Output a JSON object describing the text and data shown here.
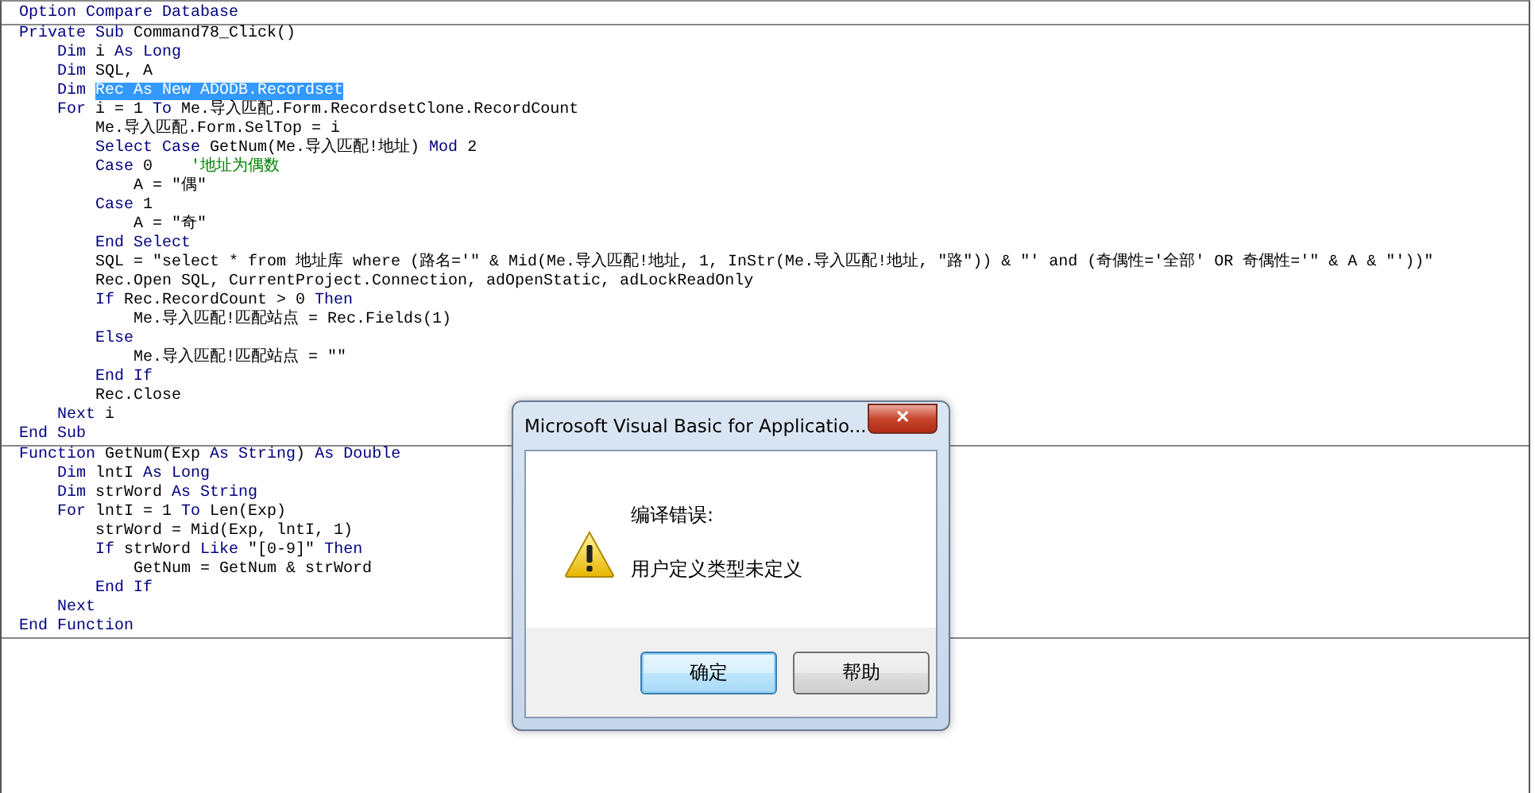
{
  "code_sections": [
    {
      "lines": [
        [
          {
            "kind": "keyword",
            "text": "Option Compare Database"
          }
        ]
      ]
    },
    {
      "lines": [
        [
          {
            "kind": "keyword",
            "text": "Private Sub "
          },
          {
            "kind": "plain",
            "text": "Command78_Click()"
          }
        ],
        [
          {
            "kind": "keyword",
            "text": "    Dim "
          },
          {
            "kind": "plain",
            "text": "i "
          },
          {
            "kind": "keyword",
            "text": "As Long"
          }
        ],
        [
          {
            "kind": "keyword",
            "text": "    Dim "
          },
          {
            "kind": "plain",
            "text": "SQL, A"
          }
        ],
        [
          {
            "kind": "keyword",
            "text": "    Dim "
          },
          {
            "kind": "selected",
            "text": "Rec As New ADODB.Recordset"
          }
        ],
        [
          {
            "kind": "keyword",
            "text": "    For "
          },
          {
            "kind": "plain",
            "text": "i = 1 "
          },
          {
            "kind": "keyword",
            "text": "To "
          },
          {
            "kind": "plain",
            "text": "Me.导入匹配.Form.RecordsetClone.RecordCount"
          }
        ],
        [
          {
            "kind": "plain",
            "text": "        Me.导入匹配.Form.SelTop = i"
          }
        ],
        [
          {
            "kind": "keyword",
            "text": "        Select Case "
          },
          {
            "kind": "plain",
            "text": "GetNum(Me.导入匹配!地址) "
          },
          {
            "kind": "keyword",
            "text": "Mod "
          },
          {
            "kind": "plain",
            "text": "2"
          }
        ],
        [
          {
            "kind": "keyword",
            "text": "        Case "
          },
          {
            "kind": "plain",
            "text": "0    "
          },
          {
            "kind": "comment",
            "text": "'地址为偶数"
          }
        ],
        [
          {
            "kind": "plain",
            "text": "            A = \"偶\""
          }
        ],
        [
          {
            "kind": "keyword",
            "text": "        Case "
          },
          {
            "kind": "plain",
            "text": "1"
          }
        ],
        [
          {
            "kind": "plain",
            "text": "            A = \"奇\""
          }
        ],
        [
          {
            "kind": "keyword",
            "text": "        End Select"
          }
        ],
        [
          {
            "kind": "plain",
            "text": "        SQL = \"select * from 地址库 where (路名='\" & Mid(Me.导入匹配!地址, 1, InStr(Me.导入匹配!地址, \"路\")) & \"' and (奇偶性='全部' OR 奇偶性='\" & A & \"'))\""
          }
        ],
        [
          {
            "kind": "plain",
            "text": "        Rec.Open SQL, CurrentProject.Connection, adOpenStatic, adLockReadOnly"
          }
        ],
        [
          {
            "kind": "keyword",
            "text": "        If "
          },
          {
            "kind": "plain",
            "text": "Rec.RecordCount > 0 "
          },
          {
            "kind": "keyword",
            "text": "Then"
          }
        ],
        [
          {
            "kind": "plain",
            "text": "            Me.导入匹配!匹配站点 = Rec.Fields(1)"
          }
        ],
        [
          {
            "kind": "keyword",
            "text": "        Else"
          }
        ],
        [
          {
            "kind": "plain",
            "text": "            Me.导入匹配!匹配站点 = \"\""
          }
        ],
        [
          {
            "kind": "keyword",
            "text": "        End If"
          }
        ],
        [
          {
            "kind": "plain",
            "text": "        Rec.Close"
          }
        ],
        [
          {
            "kind": "keyword",
            "text": "    Next "
          },
          {
            "kind": "plain",
            "text": "i"
          }
        ],
        [
          {
            "kind": "keyword",
            "text": "End Sub"
          }
        ]
      ]
    },
    {
      "lines": [
        [
          {
            "kind": "keyword",
            "text": "Function "
          },
          {
            "kind": "plain",
            "text": "GetNum(Exp "
          },
          {
            "kind": "keyword",
            "text": "As String"
          },
          {
            "kind": "plain",
            "text": ") "
          },
          {
            "kind": "keyword",
            "text": "As Double"
          }
        ],
        [
          {
            "kind": "keyword",
            "text": "    Dim "
          },
          {
            "kind": "plain",
            "text": "lntI "
          },
          {
            "kind": "keyword",
            "text": "As Long"
          }
        ],
        [
          {
            "kind": "keyword",
            "text": "    Dim "
          },
          {
            "kind": "plain",
            "text": "strWord "
          },
          {
            "kind": "keyword",
            "text": "As String"
          }
        ],
        [
          {
            "kind": "keyword",
            "text": "    For "
          },
          {
            "kind": "plain",
            "text": "lntI = 1 "
          },
          {
            "kind": "keyword",
            "text": "To "
          },
          {
            "kind": "plain",
            "text": "Len(Exp)"
          }
        ],
        [
          {
            "kind": "plain",
            "text": "        strWord = Mid(Exp, lntI, 1)"
          }
        ],
        [
          {
            "kind": "keyword",
            "text": "        If "
          },
          {
            "kind": "plain",
            "text": "strWord "
          },
          {
            "kind": "keyword",
            "text": "Like "
          },
          {
            "kind": "plain",
            "text": "\"[0-9]\" "
          },
          {
            "kind": "keyword",
            "text": "Then"
          }
        ],
        [
          {
            "kind": "plain",
            "text": "            GetNum = GetNum & strWord"
          }
        ],
        [
          {
            "kind": "keyword",
            "text": "        End If"
          }
        ],
        [
          {
            "kind": "keyword",
            "text": "    Next"
          }
        ],
        [
          {
            "kind": "keyword",
            "text": "End Function"
          }
        ]
      ]
    }
  ],
  "dialog": {
    "title": "Microsoft Visual Basic for Applicatio...",
    "close": "✕",
    "messages": [
      "编译错误:",
      "用户定义类型未定义"
    ],
    "buttons": [
      {
        "label": "确定",
        "default": true
      },
      {
        "label": "帮助",
        "default": false
      }
    ]
  }
}
